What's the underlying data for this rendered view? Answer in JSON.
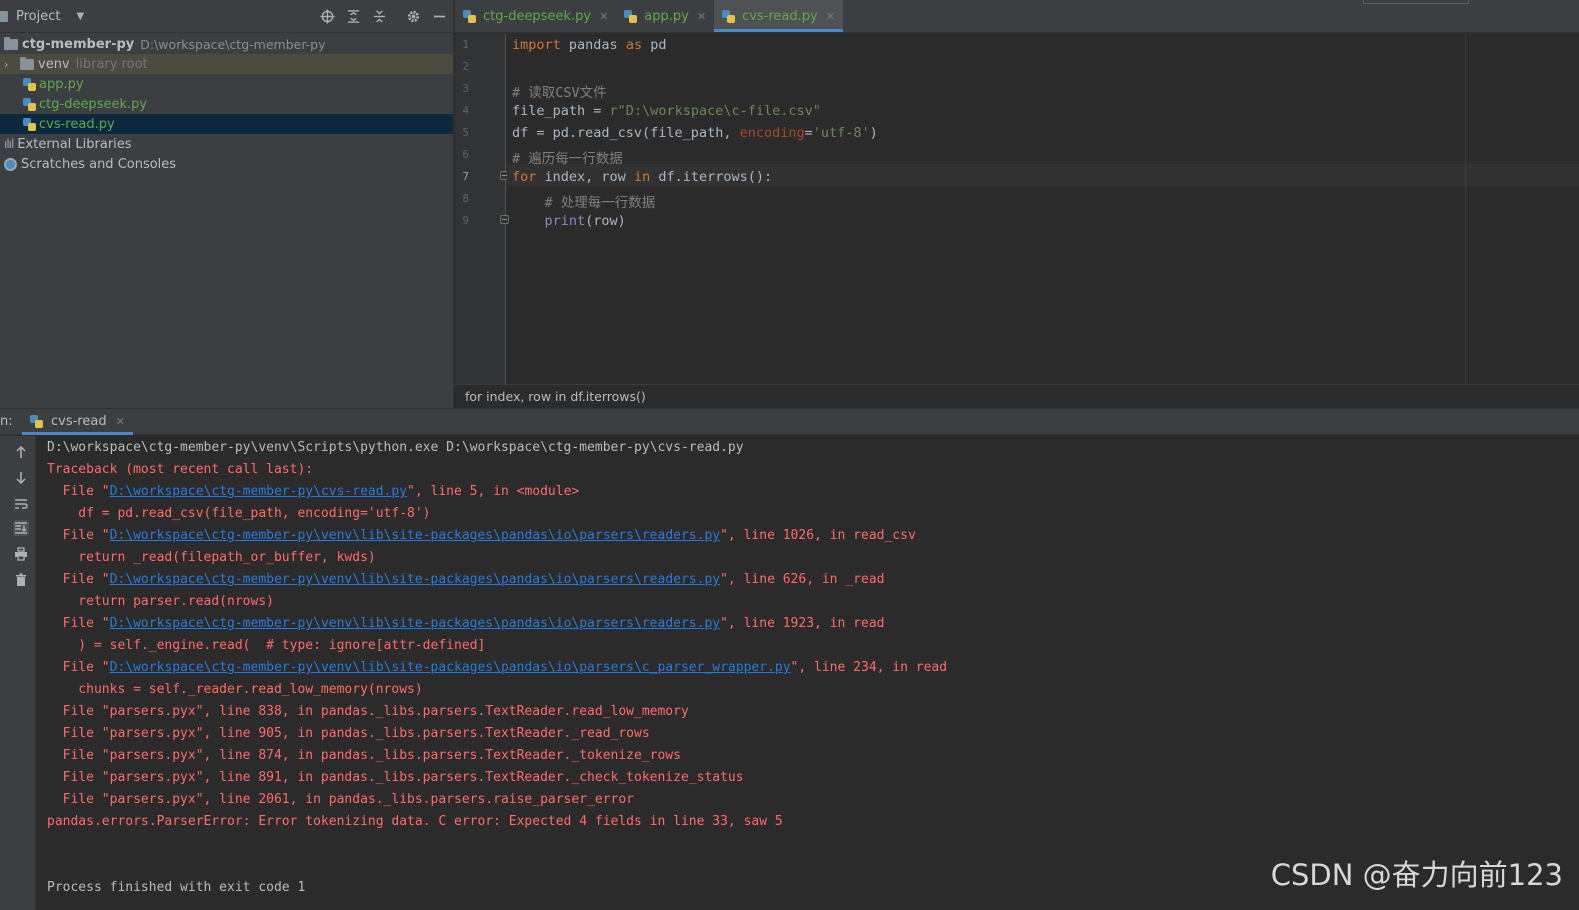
{
  "project_panel": {
    "title": "Project",
    "tree": [
      {
        "name": "ctg-member-py",
        "path": "D:\\workspace\\ctg-member-py"
      },
      {
        "name": "venv",
        "note": "library root"
      },
      {
        "name": "app.py"
      },
      {
        "name": "ctg-deepseek.py"
      },
      {
        "name": "cvs-read.py"
      },
      {
        "name": "External Libraries"
      },
      {
        "name": "Scratches and Consoles"
      }
    ]
  },
  "editor_tabs": [
    {
      "label": "ctg-deepseek.py"
    },
    {
      "label": "app.py"
    },
    {
      "label": "cvs-read.py"
    }
  ],
  "editor": {
    "line_numbers": [
      "1",
      "2",
      "3",
      "4",
      "5",
      "6",
      "7",
      "8",
      "9"
    ],
    "current_line": 7,
    "breadcrumb": "for index, row in df.iterrows()"
  },
  "code": {
    "l1_kw_import": "import",
    "l1_mod": " pandas ",
    "l1_kw_as": "as",
    "l1_alias": " pd",
    "l3": "# 读取CSV文件",
    "l4_a": "file_path = ",
    "l4_str": "r\"D:\\workspace\\c-file.csv\"",
    "l5_a": "df = pd.read_csv(file_path, ",
    "l5_param": "encoding",
    "l5_eq": "=",
    "l5_str": "'utf-8'",
    "l5_close": ")",
    "l6": "# 遍历每一行数据",
    "l7_for": "for",
    "l7_a": " index, row ",
    "l7_in": "in",
    "l7_b": " df.iterrows():",
    "l8": "    # 处理每一行数据",
    "l9_indent": "    ",
    "l9_print": "print",
    "l9_rest": "(row)"
  },
  "run_panel": {
    "label": "n:",
    "tab_label": "cvs-read"
  },
  "console": {
    "cmd": "D:\\workspace\\ctg-member-py\\venv\\Scripts\\python.exe D:\\workspace\\ctg-member-py\\cvs-read.py",
    "tb_header": "Traceback (most recent call last):",
    "f1_pre": "  File \"",
    "f1_link": "D:\\workspace\\ctg-member-py\\cvs-read.py",
    "f1_post": "\", line 5, in <module>",
    "f1_code": "    df = pd.read_csv(file_path, encoding='utf-8')",
    "f2_pre": "  File \"",
    "f2_link": "D:\\workspace\\ctg-member-py\\venv\\lib\\site-packages\\pandas\\io\\parsers\\readers.py",
    "f2_post": "\", line 1026, in read_csv",
    "f2_code": "    return _read(filepath_or_buffer, kwds)",
    "f3_pre": "  File \"",
    "f3_link": "D:\\workspace\\ctg-member-py\\venv\\lib\\site-packages\\pandas\\io\\parsers\\readers.py",
    "f3_post": "\", line 626, in _read",
    "f3_code": "    return parser.read(nrows)",
    "f4_pre": "  File \"",
    "f4_link": "D:\\workspace\\ctg-member-py\\venv\\lib\\site-packages\\pandas\\io\\parsers\\readers.py",
    "f4_post": "\", line 1923, in read",
    "f4_code": "    ) = self._engine.read(  # type: ignore[attr-defined]",
    "f5_pre": "  File \"",
    "f5_link": "D:\\workspace\\ctg-member-py\\venv\\lib\\site-packages\\pandas\\io\\parsers\\c_parser_wrapper.py",
    "f5_post": "\", line 234, in read",
    "f5_code": "    chunks = self._reader.read_low_memory(nrows)",
    "p1": "  File \"parsers.pyx\", line 838, in pandas._libs.parsers.TextReader.read_low_memory",
    "p2": "  File \"parsers.pyx\", line 905, in pandas._libs.parsers.TextReader._read_rows",
    "p3": "  File \"parsers.pyx\", line 874, in pandas._libs.parsers.TextReader._tokenize_rows",
    "p4": "  File \"parsers.pyx\", line 891, in pandas._libs.parsers.TextReader._check_tokenize_status",
    "p5": "  File \"parsers.pyx\", line 2061, in pandas._libs.parsers.raise_parser_error",
    "error": "pandas.errors.ParserError: Error tokenizing data. C error: Expected 4 fields in line 33, saw 5",
    "exit": "Process finished with exit code 1"
  },
  "watermark": "CSDN @奋力向前123",
  "colors": {
    "keyword": "#cc7832",
    "comment": "#808080",
    "string": "#6a8759",
    "error": "#ff6b68",
    "link": "#287bde",
    "accent": "#4a88c7"
  }
}
